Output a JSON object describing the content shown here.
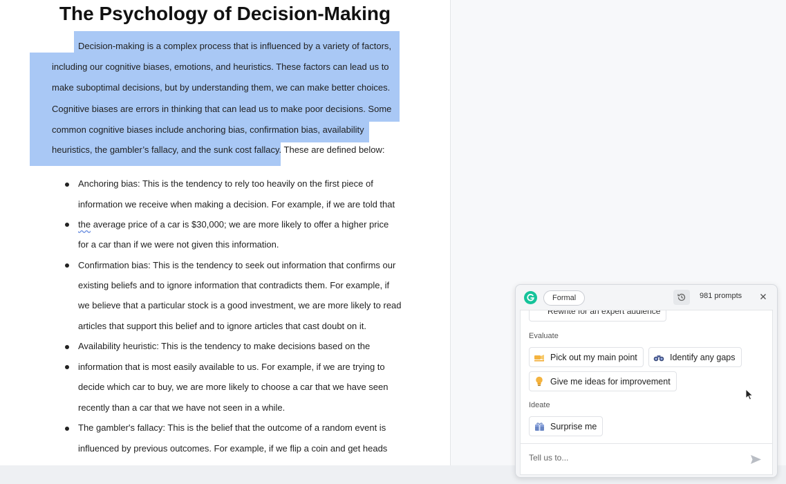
{
  "document": {
    "title": "The Psychology of Decision-Making",
    "paragraph": {
      "lines": [
        "Decision-making is a complex process that is influenced by a variety of factors,",
        "including our cognitive biases, emotions, and heuristics. These factors can lead us to",
        "make suboptimal decisions, but by understanding them, we can make better choices.",
        "Cognitive biases are errors in thinking that can lead us to make poor decisions. Some",
        "common cognitive biases include anchoring bias, confirmation bias, availability",
        "heuristics, the gambler’s fallacy, and the sunk cost fallacy."
      ],
      "tail": " These are defined below:"
    },
    "bullets": [
      {
        "lines": [
          "Anchoring bias: This is the tendency to rely too heavily on the first piece of",
          "information we receive when making a decision. For example, if we are told that"
        ]
      },
      {
        "first_word": "the",
        "lines": [
          " average price of a car is $30,000; we are more likely to offer a higher price",
          "for a car than if we were not given this information."
        ]
      },
      {
        "lines": [
          "Confirmation bias: This is the tendency to seek out information that confirms our",
          "existing beliefs and to ignore information that contradicts them. For example, if",
          "we believe that a particular stock is a good investment, we are more likely to read",
          "articles that support this belief and to ignore articles that cast doubt on it."
        ]
      },
      {
        "lines": [
          "Availability heuristic: This is the tendency to make decisions based on the"
        ]
      },
      {
        "lines": [
          "information that is most easily available to us. For example, if we are trying to",
          "decide which car to buy, we are more likely to choose a car that we have seen",
          "recently than a car that we have not seen in a while."
        ]
      },
      {
        "lines": [
          "The gambler's fallacy: This is the belief that the outcome of a random event is",
          "influenced by previous outcomes. For example, if we flip a coin and get heads"
        ]
      }
    ]
  },
  "assistant_panel": {
    "tone_label": "Formal",
    "prompts_count": "981 prompts",
    "cut_item_label": "Rewrite for an expert audience",
    "sections": [
      {
        "label": "Evaluate",
        "chips": [
          {
            "label": "Pick out my main point",
            "icon": "highlighter-icon"
          },
          {
            "label": "Identify any gaps",
            "icon": "binoculars-icon"
          },
          {
            "label": "Give me ideas for improvement",
            "icon": "lightbulb-icon"
          }
        ]
      },
      {
        "label": "Ideate",
        "chips": [
          {
            "label": "Surprise me",
            "icon": "gift-icon"
          }
        ]
      }
    ],
    "input_placeholder": "Tell us to...",
    "accent_color": "#15c39a"
  }
}
